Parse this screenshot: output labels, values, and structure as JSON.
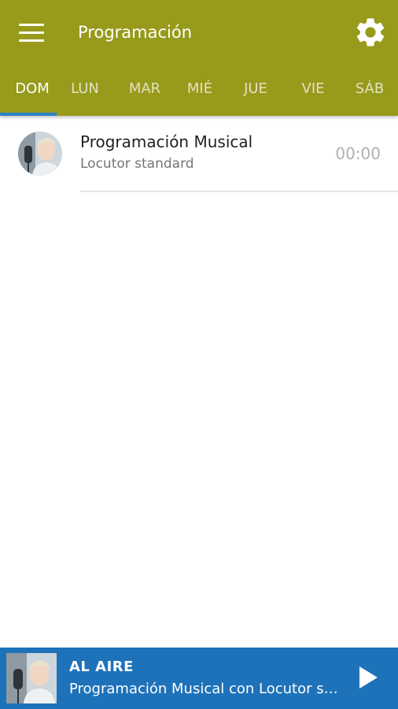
{
  "header": {
    "title": "Programación",
    "menu_icon": "hamburger-menu-icon",
    "settings_icon": "gear-icon",
    "background_color": "#989a1c"
  },
  "tabs": [
    {
      "label": "DOM",
      "active": true
    },
    {
      "label": "LUN",
      "active": false
    },
    {
      "label": "MAR",
      "active": false
    },
    {
      "label": "MIÉ",
      "active": false
    },
    {
      "label": "JUE",
      "active": false
    },
    {
      "label": "VIE",
      "active": false
    },
    {
      "label": "SÁB",
      "active": false
    }
  ],
  "tab_indicator_color": "#2a84c7",
  "schedule": [
    {
      "title": "Programación Musical",
      "host": "Locutor standard",
      "time": "00:00",
      "avatar": "host-avatar"
    }
  ],
  "player": {
    "status": "AL AIRE",
    "now_playing": "Programación Musical con Locutor standard",
    "play_icon": "play-icon",
    "background_color": "#1e72b9"
  }
}
